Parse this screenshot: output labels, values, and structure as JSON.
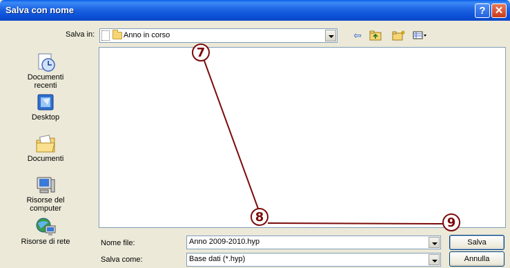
{
  "window": {
    "title": "Salva con nome"
  },
  "toolbar": {
    "look_in_label": "Salva in:",
    "look_in_value": "Anno in corso"
  },
  "places": [
    {
      "label": "Documenti\nrecenti",
      "icon": "recent-documents-icon"
    },
    {
      "label": "Desktop",
      "icon": "desktop-icon"
    },
    {
      "label": "Documenti",
      "icon": "my-documents-icon"
    },
    {
      "label": "Risorse del\ncomputer",
      "icon": "my-computer-icon"
    },
    {
      "label": "Risorse di rete",
      "icon": "network-icon"
    }
  ],
  "fields": {
    "filename_label": "Nome file:",
    "filename_value": "Anno 2009-2010.hyp",
    "filetype_label": "Salva come:",
    "filetype_value": "Base dati (*.hyp)"
  },
  "buttons": {
    "save": "Salva",
    "cancel": "Annulla"
  },
  "annotations": [
    "7",
    "8",
    "9"
  ],
  "colors": {
    "title_bar": "#0a4fd6",
    "annotation": "#7a0a0a",
    "frame_border": "#7f9db9"
  }
}
